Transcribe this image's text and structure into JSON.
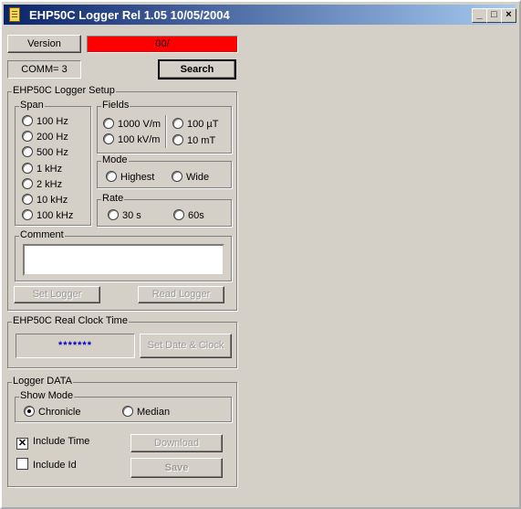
{
  "window": {
    "title": "EHP50C  Logger Rel 1.05 10/05/2004",
    "minimize": "_",
    "maximize": "□",
    "close": "×"
  },
  "top": {
    "version_button": "Version",
    "status_text": "00/",
    "status_color": "#ff0000",
    "comm_label": "COMM= 3",
    "search_button": "Search"
  },
  "setup": {
    "title": "EHP50C Logger Setup",
    "span": {
      "title": "Span",
      "options": [
        "100 Hz",
        "200 Hz",
        "500 Hz",
        "1 kHz",
        "2 kHz",
        "10  kHz",
        "100 kHz"
      ]
    },
    "fields": {
      "title": "Fields",
      "options": [
        "1000 V/m",
        "100 kV/m",
        "100 µT",
        "10 mT"
      ]
    },
    "mode": {
      "title": "Mode",
      "options": [
        "Highest",
        "Wide"
      ]
    },
    "rate": {
      "title": "Rate",
      "options": [
        "30 s",
        "60s"
      ]
    },
    "comment": {
      "title": "Comment",
      "value": ""
    },
    "set_logger_button": "Set Logger",
    "read_logger_button": "Read Logger"
  },
  "clock": {
    "title": "EHP50C Real Clock Time",
    "display": "*******",
    "display_color": "#0000c0",
    "set_button": "Set Date & Clock"
  },
  "logger_data": {
    "title": "Logger DATA",
    "show_mode": {
      "title": "Show Mode",
      "options": [
        "Chronicle",
        "Median"
      ],
      "selected": "Chronicle"
    },
    "include_time": {
      "label": "Include Time",
      "checked": true,
      "mark": "✕"
    },
    "include_id": {
      "label": "Include Id",
      "checked": false,
      "mark": ""
    },
    "download_button": "Download",
    "save_button": "Save"
  }
}
